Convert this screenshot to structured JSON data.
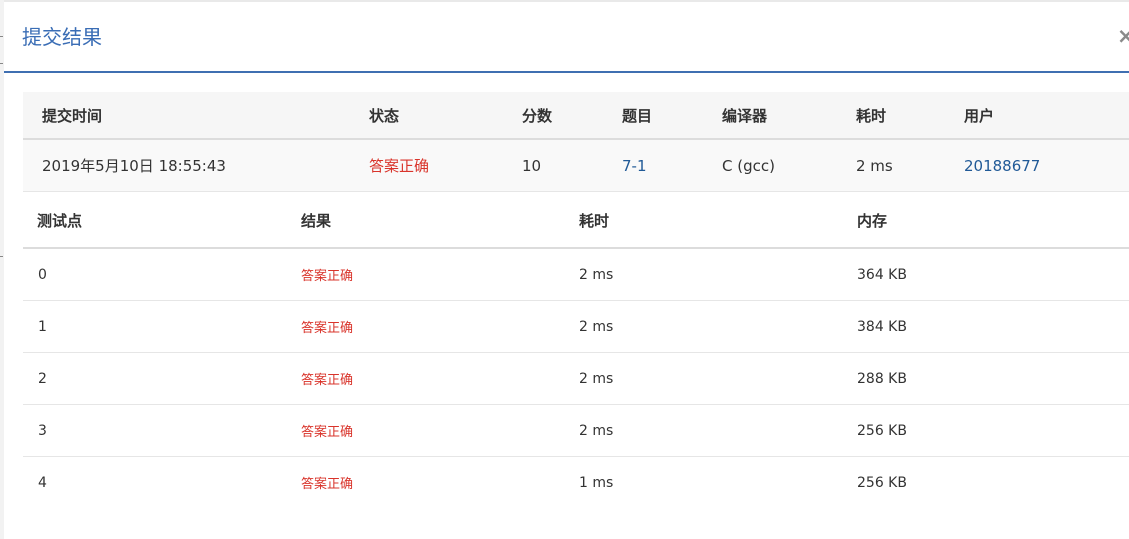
{
  "dialog": {
    "title": "提交结果",
    "close_label": "×"
  },
  "submission": {
    "headers": [
      "提交时间",
      "状态",
      "分数",
      "题目",
      "编译器",
      "耗时",
      "用户"
    ],
    "row": {
      "time": "2019年5月10日 18:55:43",
      "status": "答案正确",
      "score": "10",
      "problem": "7-1",
      "compiler": "C (gcc)",
      "duration": "2 ms",
      "user": "20188677"
    }
  },
  "testcases": {
    "headers": [
      "测试点",
      "结果",
      "耗时",
      "内存"
    ],
    "rows": [
      {
        "id": "0",
        "result": "答案正确",
        "time": "2 ms",
        "memory": "364 KB"
      },
      {
        "id": "1",
        "result": "答案正确",
        "time": "2 ms",
        "memory": "384 KB"
      },
      {
        "id": "2",
        "result": "答案正确",
        "time": "2 ms",
        "memory": "288 KB"
      },
      {
        "id": "3",
        "result": "答案正确",
        "time": "2 ms",
        "memory": "256 KB"
      },
      {
        "id": "4",
        "result": "答案正确",
        "time": "1 ms",
        "memory": "256 KB"
      }
    ]
  },
  "colors": {
    "title": "#3a6db5",
    "accepted": "#d9342b",
    "link": "#215a97",
    "header_rule": "#3f6fb1"
  }
}
